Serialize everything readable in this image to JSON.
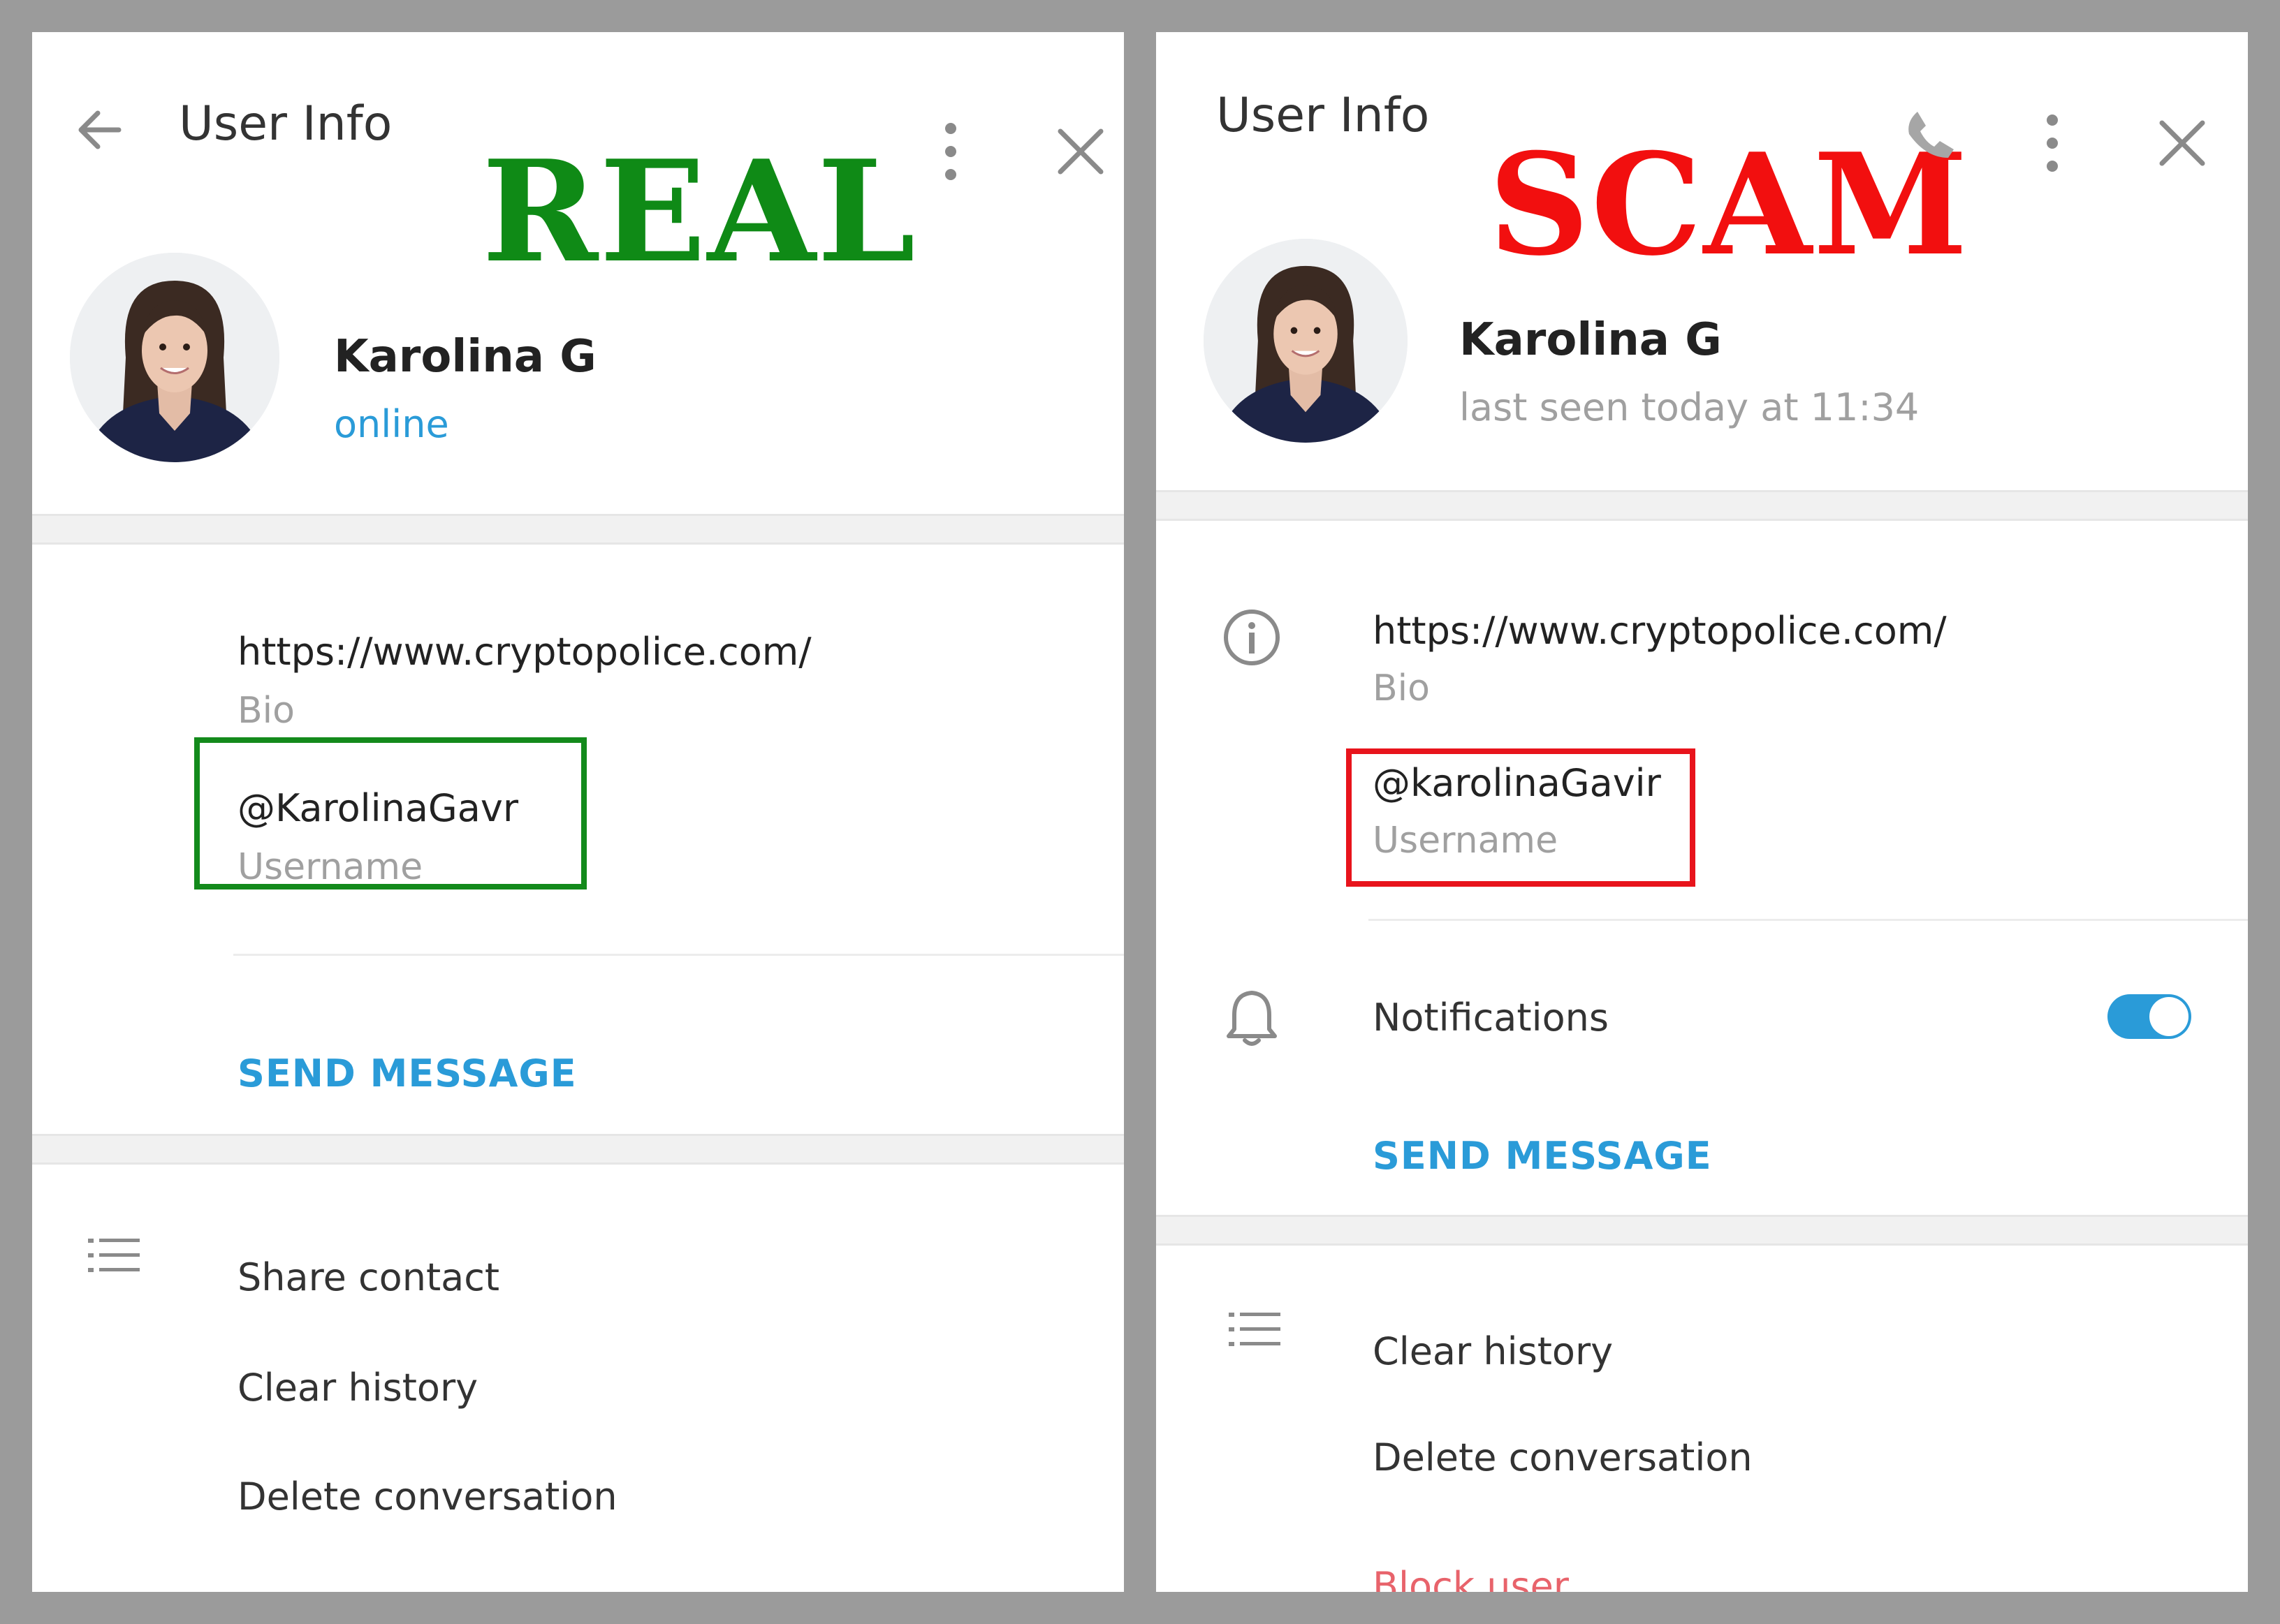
{
  "colors": {
    "accent": "#2a9bd8",
    "real_stamp": "#0f8a16",
    "scam_stamp": "#f20f0f",
    "real_box": "#138a1b",
    "scam_box": "#e8141c",
    "danger_text": "#e8636b",
    "muted": "#a0a0a0"
  },
  "left": {
    "header": {
      "title": "User Info",
      "icons": [
        "back-arrow-icon",
        "more-vertical-icon",
        "close-icon"
      ]
    },
    "stamp": "REAL",
    "profile": {
      "name": "Karolina G",
      "status": "online"
    },
    "info": {
      "bio_value": "https://www.cryptopolice.com/",
      "bio_label": "Bio",
      "username_value": "@KarolinaGavr",
      "username_label": "Username"
    },
    "send_message": "SEND MESSAGE",
    "menu": [
      "Share contact",
      "Clear history",
      "Delete conversation"
    ]
  },
  "right": {
    "header": {
      "title": "User Info",
      "icons": [
        "phone-icon",
        "more-vertical-icon",
        "close-icon"
      ]
    },
    "stamp": "SCAM",
    "profile": {
      "name": "Karolina G",
      "status": "last seen today at 11:34"
    },
    "info": {
      "bio_value": "https://www.cryptopolice.com/",
      "bio_label": "Bio",
      "username_value": "@karolinaGavir",
      "username_label": "Username"
    },
    "notifications": {
      "label": "Notifications",
      "enabled": true
    },
    "send_message": "SEND MESSAGE",
    "menu": [
      "Clear history",
      "Delete conversation"
    ],
    "block_user": "Block user"
  }
}
